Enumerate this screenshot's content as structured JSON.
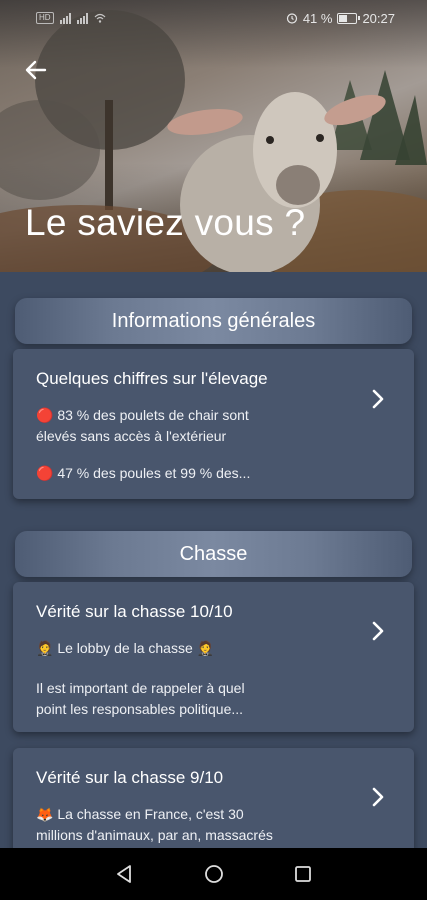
{
  "status_bar": {
    "left_badge": "HD",
    "alarm_icon": "alarm-icon",
    "battery_percent": "41 %",
    "time": "20:27"
  },
  "hero": {
    "title": "Le saviez vous ?",
    "back_icon": "arrow-left-icon",
    "image": "sheep-photo"
  },
  "sections": [
    {
      "header": "Informations générales",
      "cards": [
        {
          "title": "Quelques chiffres sur l'élevage",
          "line1": "🔴 83 % des poulets de chair sont",
          "line2": "élevés sans accès à l'extérieur",
          "line3": "🔴 47 % des poules et 99 % des..."
        }
      ]
    },
    {
      "header": "Chasse",
      "cards": [
        {
          "title": "Vérité sur la chasse 10/10",
          "line1": "🤵 Le lobby de la chasse 🤵",
          "line2": "Il est important de rappeler à quel",
          "line3": "point les responsables politique..."
        },
        {
          "title": "Vérité sur la chasse 9/10",
          "line1": "🦊 La chasse en France, c'est 30",
          "line2": "millions d'animaux, par an, massacrés"
        }
      ]
    }
  ],
  "nav_bar": {
    "back": "nav-back-icon",
    "home": "nav-home-icon",
    "recents": "nav-recents-icon"
  }
}
